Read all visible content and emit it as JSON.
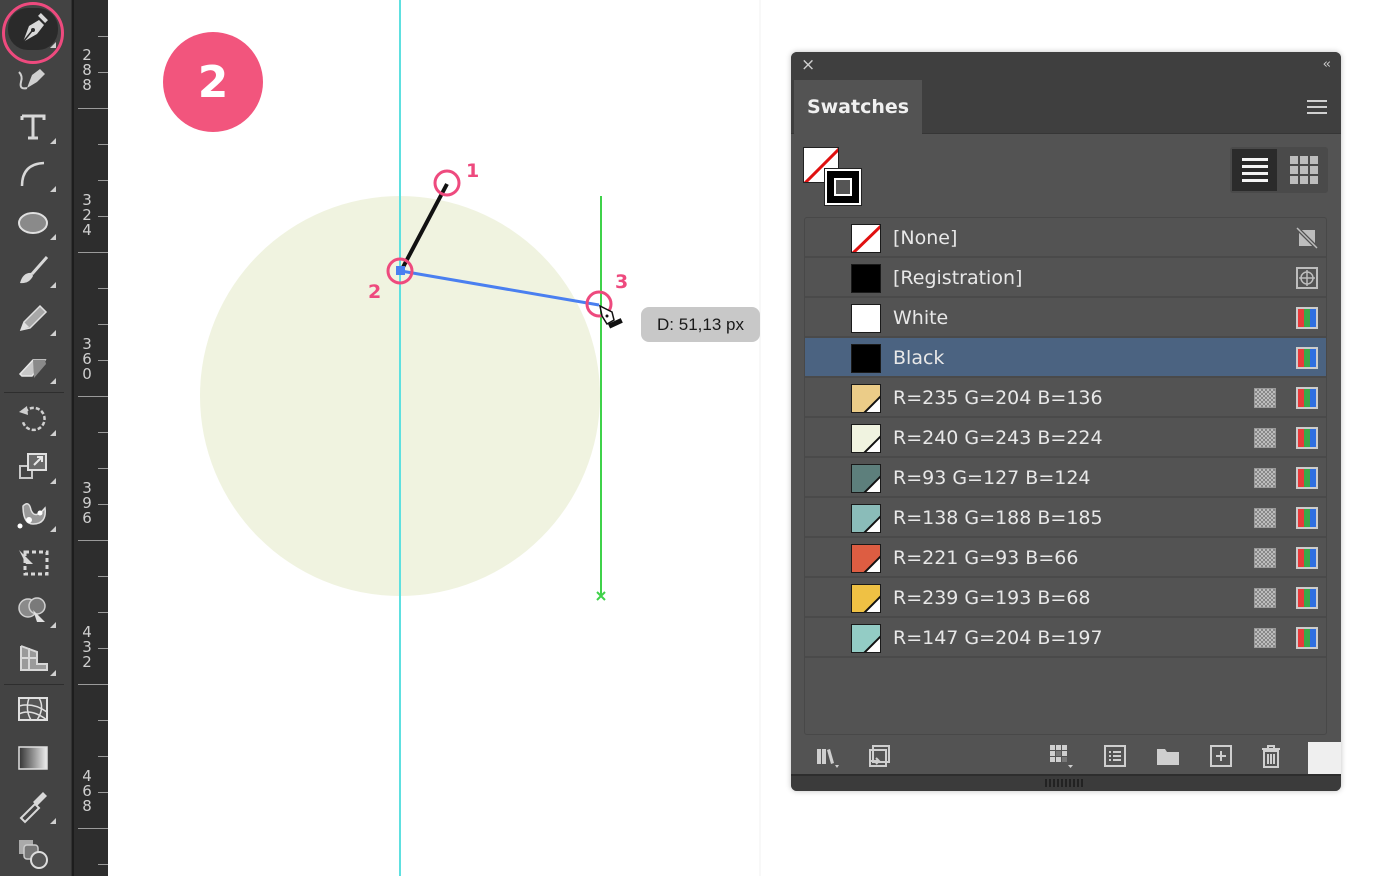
{
  "step_badge": "2",
  "toolbar": {
    "tools": [
      {
        "name": "pen-tool",
        "selected": true
      },
      {
        "name": "curvature-tool"
      },
      {
        "name": "type-tool"
      },
      {
        "name": "arc-tool"
      },
      {
        "name": "ellipse-tool"
      },
      {
        "name": "paintbrush-tool"
      },
      {
        "name": "pencil-tool"
      },
      {
        "name": "eraser-tool"
      },
      {
        "name": "rotate-tool"
      },
      {
        "name": "scale-tool"
      },
      {
        "name": "puppet-warp-tool"
      },
      {
        "name": "free-transform-tool"
      },
      {
        "name": "shape-builder-tool"
      },
      {
        "name": "perspective-grid-tool"
      },
      {
        "name": "mesh-tool"
      },
      {
        "name": "gradient-tool"
      },
      {
        "name": "eyedropper-tool"
      },
      {
        "name": "blend-tool"
      }
    ]
  },
  "ruler": {
    "labels": [
      "288",
      "324",
      "360",
      "396",
      "432",
      "468"
    ]
  },
  "canvas": {
    "point_labels": [
      "1",
      "2",
      "3"
    ],
    "tooltip": "D: 51,13 px",
    "colors": {
      "circle_fill": "#f0f3e0",
      "guide_cyan": "#5ee0e0",
      "guide_green": "#3fd24a",
      "segment_blue": "#4a7ff0",
      "highlight_pink": "#ee4a7e"
    }
  },
  "panel": {
    "close_label": "×",
    "collapse_label": "‹‹",
    "tab_label": "Swatches",
    "swatches": [
      {
        "name": "[None]",
        "type": "none",
        "color": "#ffffff",
        "icon": "no-edit-icon"
      },
      {
        "name": "[Registration]",
        "type": "registration",
        "color": "#000000",
        "icon": "registration-icon"
      },
      {
        "name": "White",
        "type": "process",
        "color": "#ffffff",
        "icon": "rgb-mode-icon"
      },
      {
        "name": "Black",
        "type": "process",
        "color": "#000000",
        "icon": "rgb-mode-icon",
        "selected": true
      },
      {
        "name": "R=235 G=204 B=136",
        "type": "global",
        "color": "#ebcc88",
        "icon": "rgb-mode-icon"
      },
      {
        "name": "R=240 G=243 B=224",
        "type": "global",
        "color": "#f0f3e0",
        "icon": "rgb-mode-icon"
      },
      {
        "name": "R=93 G=127 B=124",
        "type": "global",
        "color": "#5d7f7c",
        "icon": "rgb-mode-icon"
      },
      {
        "name": "R=138 G=188 B=185",
        "type": "global",
        "color": "#8abcb9",
        "icon": "rgb-mode-icon"
      },
      {
        "name": "R=221 G=93 B=66",
        "type": "global",
        "color": "#dd5d42",
        "icon": "rgb-mode-icon"
      },
      {
        "name": "R=239 G=193 B=68",
        "type": "global",
        "color": "#efc144",
        "icon": "rgb-mode-icon"
      },
      {
        "name": "R=147 G=204 B=197",
        "type": "global",
        "color": "#93ccc5",
        "icon": "rgb-mode-icon"
      }
    ],
    "bottom_buttons": [
      "swatch-libraries-menu",
      "place-swatches-in-cc-library",
      "show-swatch-kinds-menu",
      "swatch-options",
      "new-color-group",
      "new-swatch",
      "delete-swatch"
    ]
  }
}
